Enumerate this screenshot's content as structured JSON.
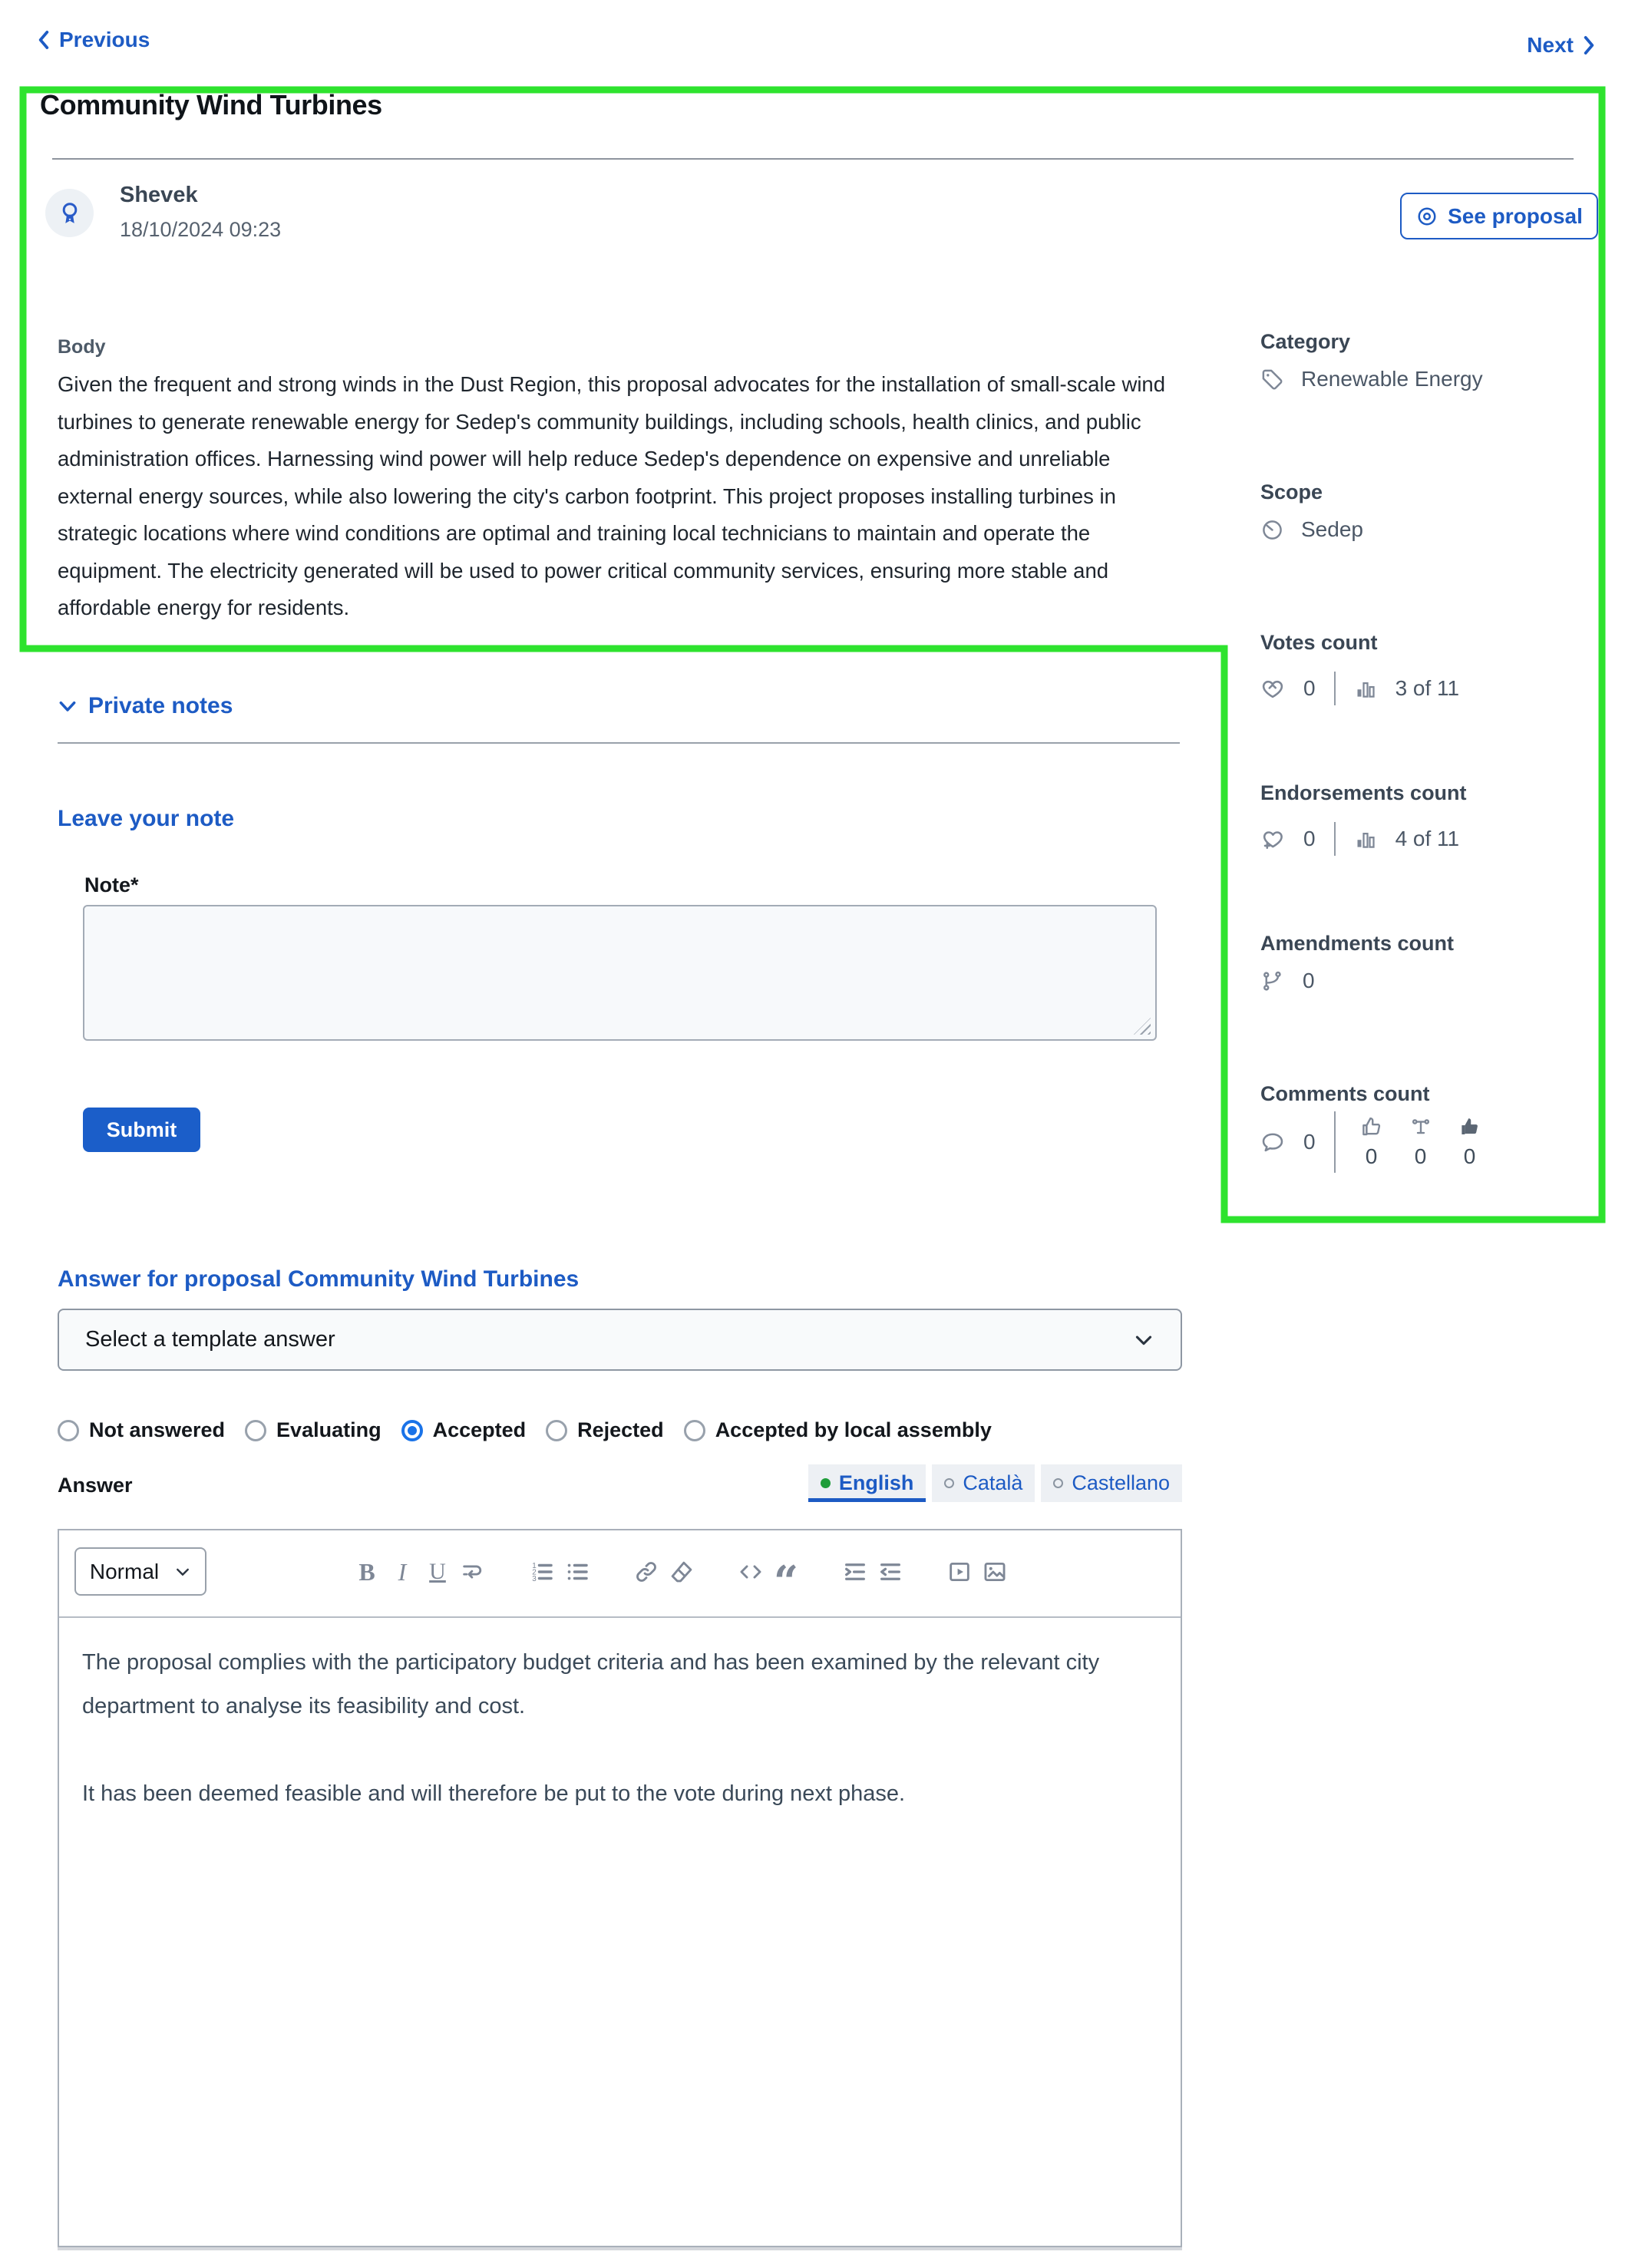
{
  "nav": {
    "previous_label": "Previous",
    "next_label": "Next"
  },
  "proposal": {
    "title": "Community Wind Turbines",
    "author": {
      "name": "Shevek",
      "timestamp": "18/10/2024 09:23",
      "avatar_icon": "award-icon"
    },
    "see_proposal_label": "See proposal",
    "body_label": "Body",
    "body": "Given the frequent and strong winds in the Dust Region, this proposal advocates for the installation of small-scale wind turbines to generate renewable energy for Sedep's community buildings, including schools, health clinics, and public administration offices. Harnessing wind power will help reduce Sedep's dependence on expensive and unreliable external energy sources, while also lowering the city's carbon footprint. This project proposes installing turbines in strategic locations where wind conditions are optimal and training local technicians to maintain and operate the equipment. The electricity generated will be used to power critical community services, ensuring more stable and affordable energy for residents."
  },
  "sidebar": {
    "category": {
      "label": "Category",
      "value": "Renewable Energy",
      "icon": "tag-icon"
    },
    "scope": {
      "label": "Scope",
      "value": "Sedep",
      "icon": "timer-icon"
    },
    "votes": {
      "label": "Votes count",
      "count": "0",
      "ranking": "3 of 11",
      "icons": [
        "heart-hand-icon",
        "bar-chart-icon"
      ]
    },
    "endorsements": {
      "label": "Endorsements count",
      "count": "0",
      "ranking": "4 of 11",
      "icons": [
        "heart-plus-icon",
        "bar-chart-icon"
      ]
    },
    "amendments": {
      "label": "Amendments count",
      "count": "0",
      "icon": "git-branch-icon"
    },
    "comments": {
      "label": "Comments count",
      "total": "0",
      "positive": "0",
      "neutral": "0",
      "negative": "0",
      "icons": [
        "chat-bubble-icon",
        "thumb-up-outline-icon",
        "scale-icon",
        "thumb-up-filled-icon"
      ]
    }
  },
  "private_notes": {
    "section_title": "Private notes",
    "leave_note_title": "Leave your note",
    "note_label": "Note*",
    "note_value": "",
    "submit_label": "Submit"
  },
  "answer": {
    "title": "Answer for proposal Community Wind Turbines",
    "template_placeholder": "Select a template answer",
    "statuses": [
      {
        "label": "Not answered",
        "selected": false
      },
      {
        "label": "Evaluating",
        "selected": false
      },
      {
        "label": "Accepted",
        "selected": true
      },
      {
        "label": "Rejected",
        "selected": false
      },
      {
        "label": "Accepted by local assembly",
        "selected": false
      }
    ],
    "answer_label": "Answer",
    "languages": [
      {
        "label": "English",
        "active": true
      },
      {
        "label": "Català",
        "active": false
      },
      {
        "label": "Castellano",
        "active": false
      }
    ],
    "editor": {
      "format": "Normal",
      "bold_label": "B",
      "italic_label": "I",
      "underline_label": "U",
      "quote_glyph": "“",
      "paragraph_1": "The proposal complies with the participatory budget criteria and has been examined by the relevant city department to analyse its feasibility and cost.",
      "paragraph_2": "It has been deemed feasible and will therefore be put to the vote during next phase."
    }
  },
  "colors": {
    "accent_blue": "#1d5bc4",
    "submit_blue": "#1b5ec9",
    "annotation_green": "#2ee32e",
    "radio_selected_blue": "#1a73e8",
    "language_active_dot_green": "#1f9d3a"
  }
}
